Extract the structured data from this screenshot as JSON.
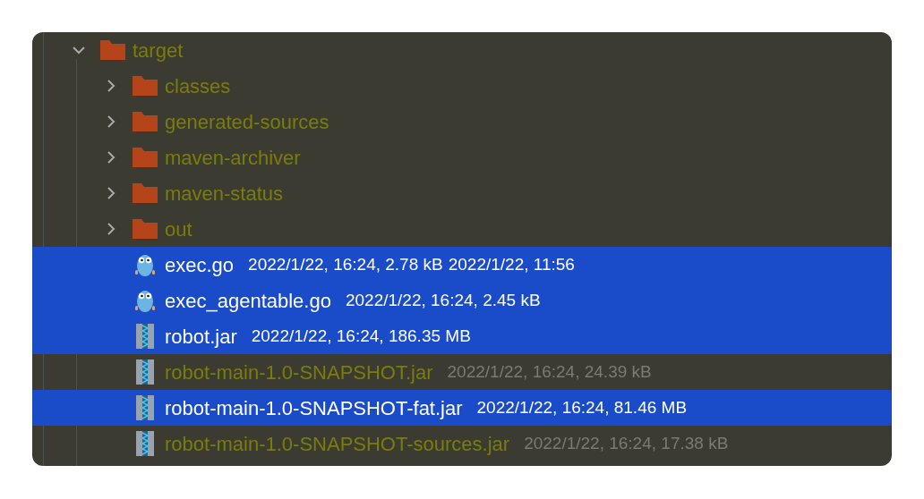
{
  "tree": [
    {
      "name": "target",
      "kind": "folder",
      "expanded": true,
      "selected": false,
      "children": [
        {
          "name": "classes",
          "kind": "folder",
          "expanded": false,
          "selected": false
        },
        {
          "name": "generated-sources",
          "kind": "folder",
          "expanded": false,
          "selected": false
        },
        {
          "name": "maven-archiver",
          "kind": "folder",
          "expanded": false,
          "selected": false
        },
        {
          "name": "maven-status",
          "kind": "folder",
          "expanded": false,
          "selected": false
        },
        {
          "name": "out",
          "kind": "folder",
          "expanded": false,
          "selected": false
        },
        {
          "name": "exec.go",
          "kind": "go",
          "selected": true,
          "details": "2022/1/22, 16:24, 2.78 kB",
          "extra": "2022/1/22, 11:56"
        },
        {
          "name": "exec_agentable.go",
          "kind": "go",
          "selected": true,
          "details": "2022/1/22, 16:24, 2.45 kB"
        },
        {
          "name": "robot.jar",
          "kind": "jar",
          "selected": true,
          "details": "2022/1/22, 16:24, 186.35 MB"
        },
        {
          "name": "robot-main-1.0-SNAPSHOT.jar",
          "kind": "jar",
          "selected": false,
          "details": "2022/1/22, 16:24, 24.39 kB"
        },
        {
          "name": "robot-main-1.0-SNAPSHOT-fat.jar",
          "kind": "jar",
          "selected": true,
          "details": "2022/1/22, 16:24, 81.46 MB"
        },
        {
          "name": "robot-main-1.0-SNAPSHOT-sources.jar",
          "kind": "jar",
          "selected": false,
          "details": "2022/1/22, 16:24, 17.38 kB"
        }
      ]
    }
  ]
}
